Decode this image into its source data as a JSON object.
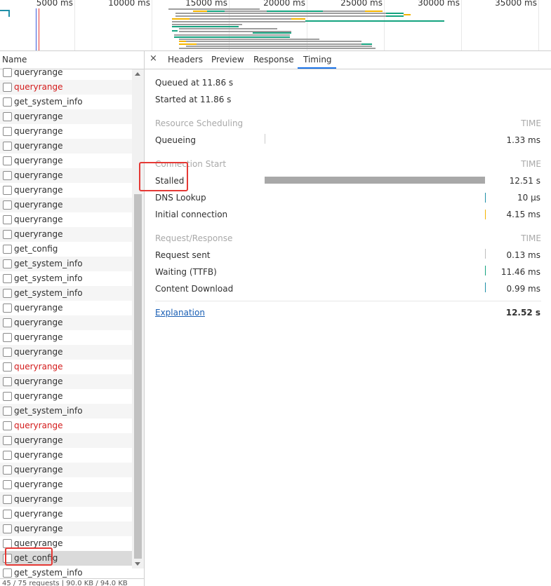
{
  "overview": {
    "ticks": [
      "5000 ms",
      "10000 ms",
      "15000 ms",
      "20000 ms",
      "25000 ms",
      "30000 ms",
      "35000 ms"
    ]
  },
  "name_pane": {
    "header": "Name",
    "rows": [
      {
        "name": "queryrange",
        "error": false
      },
      {
        "name": "queryrange",
        "error": true
      },
      {
        "name": "get_system_info",
        "error": false
      },
      {
        "name": "queryrange",
        "error": false
      },
      {
        "name": "queryrange",
        "error": false
      },
      {
        "name": "queryrange",
        "error": false
      },
      {
        "name": "queryrange",
        "error": false
      },
      {
        "name": "queryrange",
        "error": false
      },
      {
        "name": "queryrange",
        "error": false
      },
      {
        "name": "queryrange",
        "error": false
      },
      {
        "name": "queryrange",
        "error": false
      },
      {
        "name": "queryrange",
        "error": false
      },
      {
        "name": "get_config",
        "error": false
      },
      {
        "name": "get_system_info",
        "error": false
      },
      {
        "name": "get_system_info",
        "error": false
      },
      {
        "name": "get_system_info",
        "error": false
      },
      {
        "name": "queryrange",
        "error": false
      },
      {
        "name": "queryrange",
        "error": false
      },
      {
        "name": "queryrange",
        "error": false
      },
      {
        "name": "queryrange",
        "error": false
      },
      {
        "name": "queryrange",
        "error": true
      },
      {
        "name": "queryrange",
        "error": false
      },
      {
        "name": "queryrange",
        "error": false
      },
      {
        "name": "get_system_info",
        "error": false
      },
      {
        "name": "queryrange",
        "error": true
      },
      {
        "name": "queryrange",
        "error": false
      },
      {
        "name": "queryrange",
        "error": false
      },
      {
        "name": "queryrange",
        "error": false
      },
      {
        "name": "queryrange",
        "error": false
      },
      {
        "name": "queryrange",
        "error": false
      },
      {
        "name": "queryrange",
        "error": false
      },
      {
        "name": "queryrange",
        "error": false
      },
      {
        "name": "queryrange",
        "error": false
      },
      {
        "name": "get_config",
        "error": false,
        "selected": true
      },
      {
        "name": "get_system_info",
        "error": false
      }
    ],
    "status": "45 / 75 requests | 90.0 KB / 94.0 KB"
  },
  "detail": {
    "close": "×",
    "tabs": [
      "Headers",
      "Preview",
      "Response",
      "Timing"
    ],
    "active_tab": "Timing",
    "queued_at": "Queued at 11.86 s",
    "started_at": "Started at 11.86 s",
    "time_label": "TIME",
    "sections": [
      {
        "title": "Resource Scheduling",
        "rows": [
          {
            "label": "Queueing",
            "value": "1.33 ms",
            "color": "#cccccc",
            "start_fraction": 0.0,
            "length_fraction": 0.0
          }
        ]
      },
      {
        "title": "Connection Start",
        "rows": [
          {
            "label": "Stalled",
            "value": "12.51 s",
            "color": "#a8a8a8",
            "start_fraction": 0.0,
            "length_fraction": 0.999
          },
          {
            "label": "DNS Lookup",
            "value": "10 µs",
            "color": "#1f8fa8",
            "start_fraction": 0.999,
            "length_fraction": 0.0
          },
          {
            "label": "Initial connection",
            "value": "4.15 ms",
            "color": "#f4b400",
            "start_fraction": 0.999,
            "length_fraction": 0.0
          }
        ]
      },
      {
        "title": "Request/Response",
        "rows": [
          {
            "label": "Request sent",
            "value": "0.13 ms",
            "color": "#bdbdbd",
            "start_fraction": 0.999,
            "length_fraction": 0.0
          },
          {
            "label": "Waiting (TTFB)",
            "value": "11.46 ms",
            "color": "#14a37f",
            "start_fraction": 0.999,
            "length_fraction": 0.0
          },
          {
            "label": "Content Download",
            "value": "0.99 ms",
            "color": "#1f8fa8",
            "start_fraction": 0.999,
            "length_fraction": 0.0
          }
        ]
      }
    ],
    "explanation_link": "Explanation",
    "total": "12.52 s"
  },
  "colors": {
    "error_text": "#d31a1a",
    "highlight_box": "#e53935",
    "tab_accent": "#1a73e8",
    "link": "#1a5fb4"
  }
}
